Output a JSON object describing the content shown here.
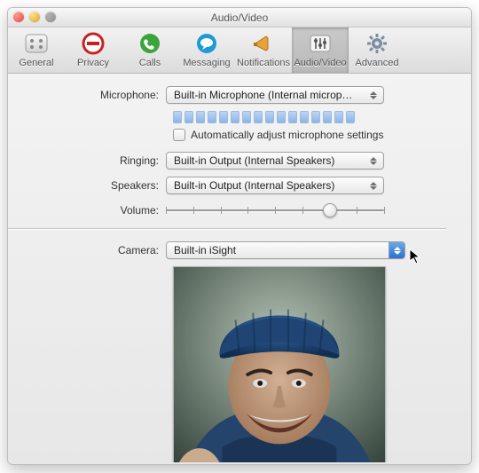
{
  "window": {
    "title": "Audio/Video"
  },
  "toolbar": {
    "items": [
      {
        "label": "General"
      },
      {
        "label": "Privacy"
      },
      {
        "label": "Calls"
      },
      {
        "label": "Messaging"
      },
      {
        "label": "Notifications"
      },
      {
        "label": "Audio/Video"
      },
      {
        "label": "Advanced"
      }
    ]
  },
  "form": {
    "mic_label": "Microphone:",
    "mic_value": "Built-in Microphone (Internal microp…",
    "auto_label": "Automatically adjust microphone settings",
    "ringing_label": "Ringing:",
    "ringing_value": "Built-in Output (Internal Speakers)",
    "speakers_label": "Speakers:",
    "speakers_value": "Built-in Output (Internal Speakers)",
    "volume_label": "Volume:",
    "volume_percent": 75,
    "camera_label": "Camera:",
    "camera_value": "Built-in iSight"
  }
}
